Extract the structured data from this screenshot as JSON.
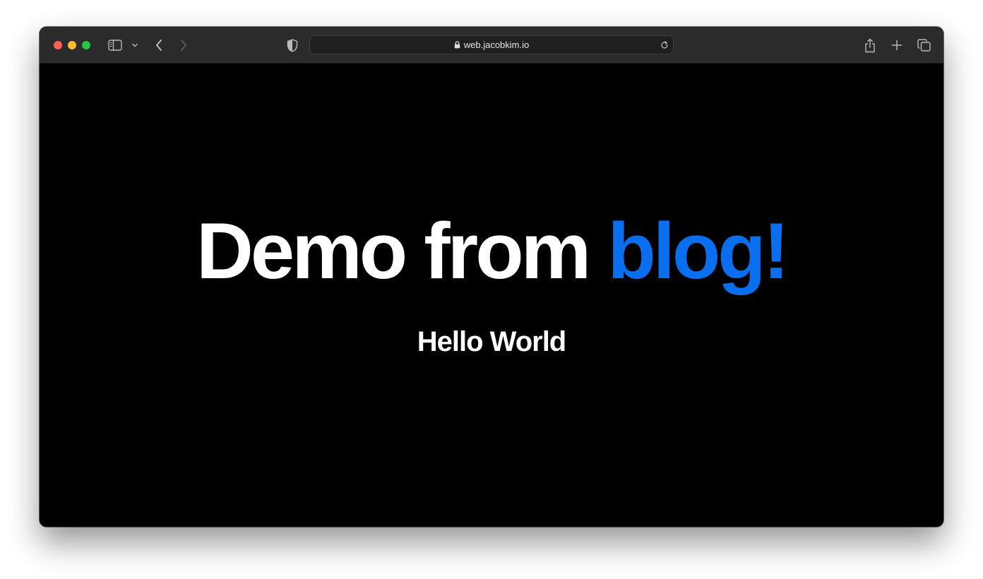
{
  "browser": {
    "url": "web.jacobkim.io",
    "icons": {
      "close": "close-button",
      "minimize": "minimize-button",
      "zoom": "zoom-button",
      "sidebar": "sidebar-icon",
      "sidebar_menu": "chevron-down-icon",
      "back": "back-arrow-icon",
      "forward": "forward-arrow-icon",
      "privacy": "shield-icon",
      "lock": "lock-icon",
      "reload": "reload-icon",
      "share": "share-icon",
      "new_tab": "plus-icon",
      "tab_overview": "tabs-icon"
    },
    "colors": {
      "close": "#ff5f57",
      "minimize": "#febc2e",
      "zoom": "#28c840"
    }
  },
  "page": {
    "headline_part1": "Demo from ",
    "headline_accent": "blog!",
    "subheadline": "Hello World",
    "colors": {
      "background": "#000000",
      "text": "#ffffff",
      "accent": "#0a6fee"
    }
  }
}
